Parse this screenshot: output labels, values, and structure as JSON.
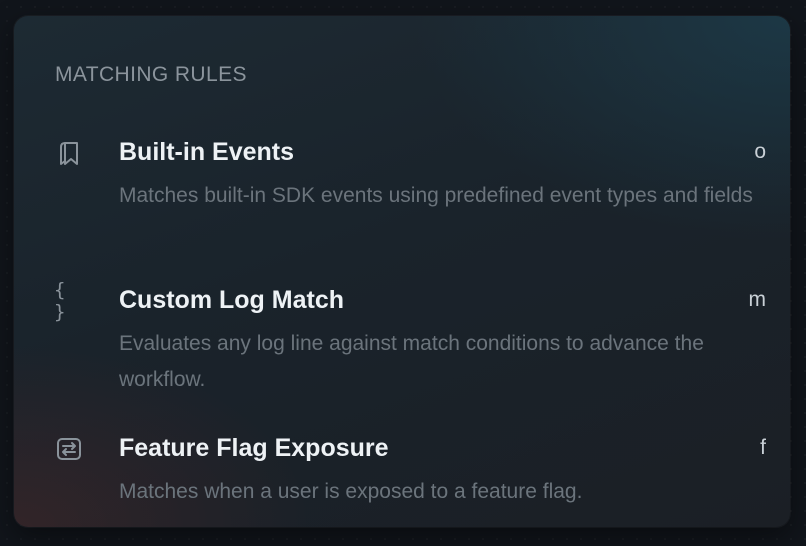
{
  "section": {
    "title": "MATCHING RULES"
  },
  "rules": [
    {
      "icon": "bookmarks-icon",
      "title": "Built-in Events",
      "description": "Matches built-in SDK events using predefined event types and fields",
      "shortcut": "o"
    },
    {
      "icon": "braces-icon",
      "icon_text": "{ }",
      "title": "Custom Log Match",
      "description": "Evaluates any log line against match conditions to advance the workflow.",
      "shortcut": "m"
    },
    {
      "icon": "arrows-exchange-icon",
      "title": "Feature Flag Exposure",
      "description": "Matches when a user is exposed to a feature flag.",
      "shortcut": "f"
    }
  ]
}
